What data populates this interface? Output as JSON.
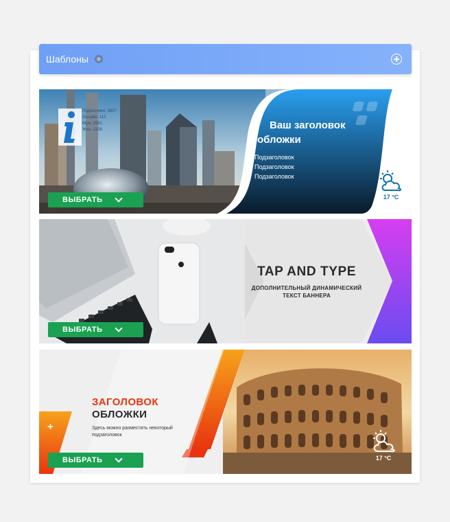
{
  "header": {
    "title": "Шаблоны",
    "add_icon": "plus-circle-icon",
    "loader_icon": "loading-icon"
  },
  "select_label": "ВЫБРАТЬ",
  "templates": [
    {
      "title_line1": "Ваш заголовок",
      "title_line2": "обложки",
      "bullets": [
        "Подзаголовок",
        "Подзаголовок",
        "Подзаголовок"
      ],
      "stats": [
        "Подписчики: 3907",
        "Онлайн: 112",
        "Муж: 2581",
        "Жен: 1326"
      ],
      "temperature": "17 °C",
      "accent": "#1d90e0"
    },
    {
      "title": "TAP AND TYPE",
      "subtitle_line1": "ДОПОЛНИТЕЛЬНЫЙ ДИНАМИЧЕСКИЙ",
      "subtitle_line2": "ТЕКСТ БАННЕРА",
      "accent": "#b13ee8"
    },
    {
      "title_line1": "ЗАГОЛОВОК",
      "title_line2": "ОБЛОЖКИ",
      "subtitle_line1": "Здесь можно разместить некоторый",
      "subtitle_line2": "подзаголовок",
      "plus": "+",
      "temperature": "17 °C",
      "accent": "#e8350f"
    }
  ]
}
